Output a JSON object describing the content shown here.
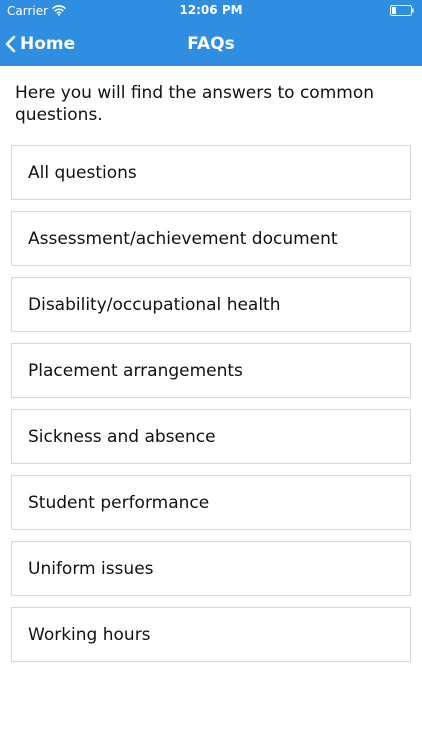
{
  "status_bar": {
    "carrier": "Carrier",
    "time": "12:06 PM"
  },
  "nav": {
    "back_label": "Home",
    "title": "FAQs"
  },
  "intro_text": "Here you will find the answers to common questions.",
  "faq_items": [
    {
      "label": "All questions"
    },
    {
      "label": "Assessment/achievement document"
    },
    {
      "label": "Disability/occupational health"
    },
    {
      "label": "Placement arrangements"
    },
    {
      "label": "Sickness and absence"
    },
    {
      "label": "Student performance"
    },
    {
      "label": "Uniform issues"
    },
    {
      "label": "Working hours"
    }
  ],
  "colors": {
    "header_background": "#2f8ee0",
    "header_text": "#ffffff",
    "item_border": "#d6d6d6",
    "text": "#111111"
  },
  "icons": {
    "wifi": "wifi-icon",
    "battery": "battery-icon",
    "back": "chevron-left-icon"
  }
}
